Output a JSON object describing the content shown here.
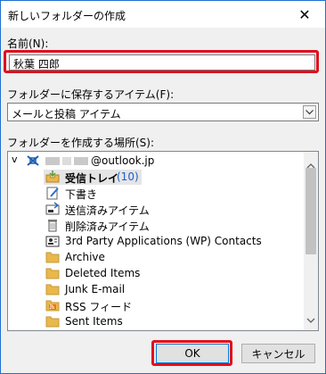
{
  "dialog": {
    "title": "新しいフォルダーの作成",
    "close_glyph": "✕"
  },
  "name_field": {
    "label": "名前(N):",
    "value": "秋葉 四郎"
  },
  "type_field": {
    "label": "フォルダーに保存するアイテム(F):",
    "value": "メールと投稿 アイテム"
  },
  "location_field": {
    "label": "フォルダーを作成する場所(S):"
  },
  "tree": {
    "root": {
      "expander": "v",
      "account": "@outlook.jp",
      "icon": "mailbox-icon"
    },
    "items": [
      {
        "label": "受信トレイ",
        "count": "(10)",
        "icon": "inbox-icon",
        "selected": true
      },
      {
        "label": "下書き",
        "icon": "drafts-icon"
      },
      {
        "label": "送信済みアイテム",
        "icon": "sent-icon"
      },
      {
        "label": "削除済みアイテム",
        "icon": "trash-icon"
      },
      {
        "label": "3rd Party Applications (WP) Contacts",
        "icon": "contacts-icon"
      },
      {
        "label": "Archive",
        "icon": "folder-icon"
      },
      {
        "label": "Deleted Items",
        "icon": "folder-icon"
      },
      {
        "label": "Junk E-mail",
        "icon": "folder-icon"
      },
      {
        "label": "RSS フィード",
        "icon": "rss-icon"
      },
      {
        "label": "Sent Items",
        "icon": "folder-icon"
      }
    ]
  },
  "buttons": {
    "ok": "OK",
    "cancel": "キャンセル"
  },
  "colors": {
    "highlight": "#e0101e",
    "count_blue": "#1a5fd0",
    "folder_yellow": "#e8b84a"
  }
}
